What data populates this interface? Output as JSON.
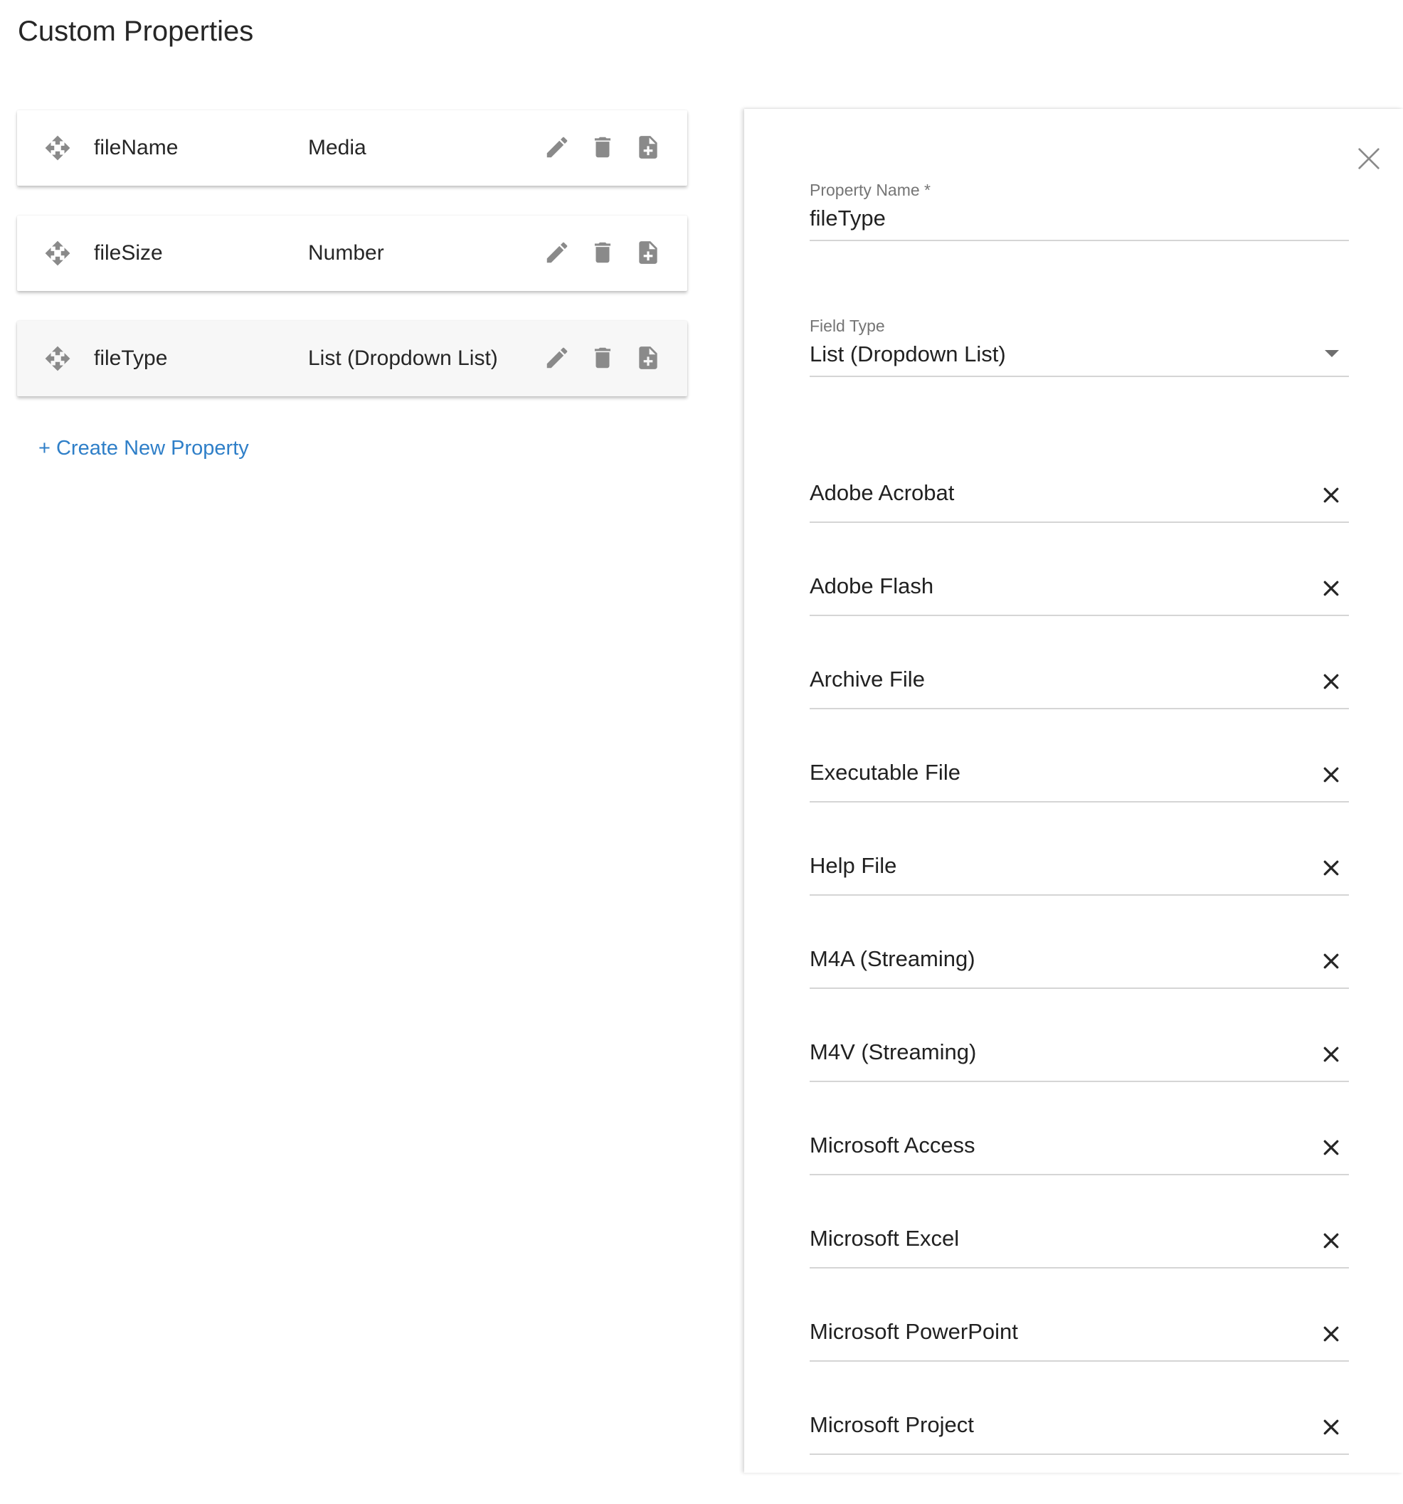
{
  "page": {
    "title": "Custom Properties"
  },
  "properties": [
    {
      "name": "fileName",
      "type": "Media"
    },
    {
      "name": "fileSize",
      "type": "Number"
    },
    {
      "name": "fileType",
      "type": "List (Dropdown List)"
    }
  ],
  "create_link_label": "+ Create New Property",
  "editor": {
    "property_name_label": "Property Name *",
    "property_name_value": "fileType",
    "field_type_label": "Field Type",
    "field_type_value": "List (Dropdown List)",
    "options": [
      "Adobe Acrobat",
      "Adobe Flash",
      "Archive File",
      "Executable File",
      "Help File",
      "M4A (Streaming)",
      "M4V (Streaming)",
      "Microsoft Access",
      "Microsoft Excel",
      "Microsoft PowerPoint",
      "Microsoft Project"
    ]
  },
  "icons": {
    "drag": "move-icon",
    "edit": "pencil-icon",
    "delete": "trash-icon",
    "duplicate": "file-plus-icon",
    "close": "close-icon",
    "remove": "x-icon",
    "dropdown": "caret-down-icon"
  },
  "colors": {
    "link": "#2f7fc8",
    "icon": "#8a8a8a",
    "selected_row": "#f7f7f7"
  }
}
